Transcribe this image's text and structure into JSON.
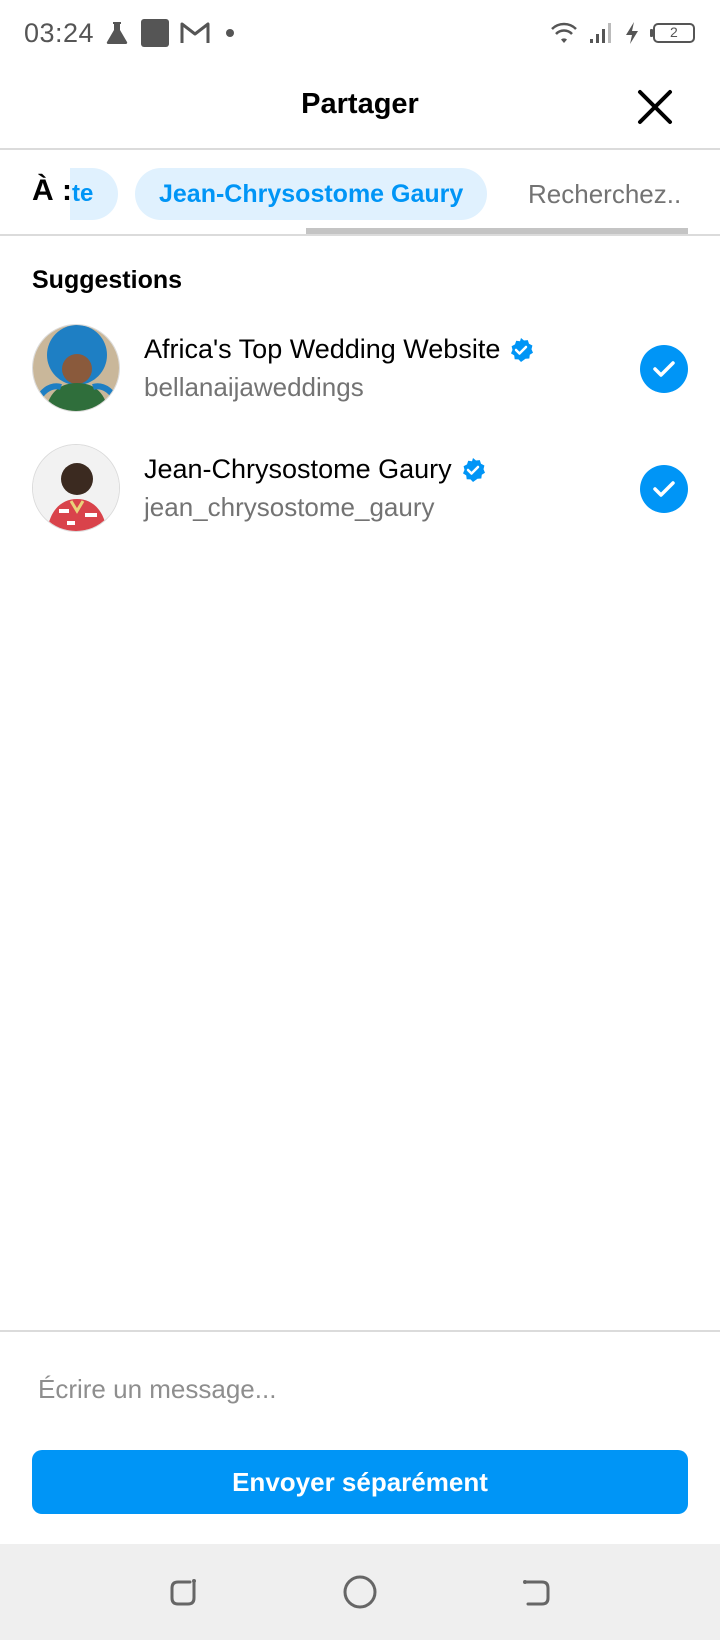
{
  "status_bar": {
    "time": "03:24",
    "battery_level": "2",
    "icons": [
      "flask-icon",
      "square-notification-icon",
      "gmail-icon",
      "dot-icon",
      "wifi-icon",
      "signal-icon",
      "charging-icon",
      "battery-icon"
    ]
  },
  "header": {
    "title": "Partager",
    "close_icon": "close-icon"
  },
  "recipients": {
    "to_label": "À :",
    "partial_chip_text": "te",
    "chips": [
      {
        "label": "Jean-Chrysostome Gaury"
      }
    ],
    "search_placeholder": "Recherchez.."
  },
  "suggestions": {
    "title": "Suggestions",
    "items": [
      {
        "name": "Africa's Top Wedding Website",
        "handle": "bellanaijaweddings",
        "verified": true,
        "selected": true
      },
      {
        "name": "Jean-Chrysostome Gaury",
        "handle": "jean_chrysostome_gaury",
        "verified": true,
        "selected": true
      }
    ]
  },
  "composer": {
    "message_placeholder": "Écrire un message...",
    "message_value": "",
    "send_label": "Envoyer séparément"
  },
  "nav_bar": {
    "buttons": [
      "recent-apps-icon",
      "home-icon",
      "back-icon"
    ]
  },
  "colors": {
    "accent": "#0095f6",
    "chip_bg": "#e0f1fe",
    "divider": "#dbdbdb",
    "secondary_text": "#737373",
    "nav_bg": "#efefef"
  }
}
